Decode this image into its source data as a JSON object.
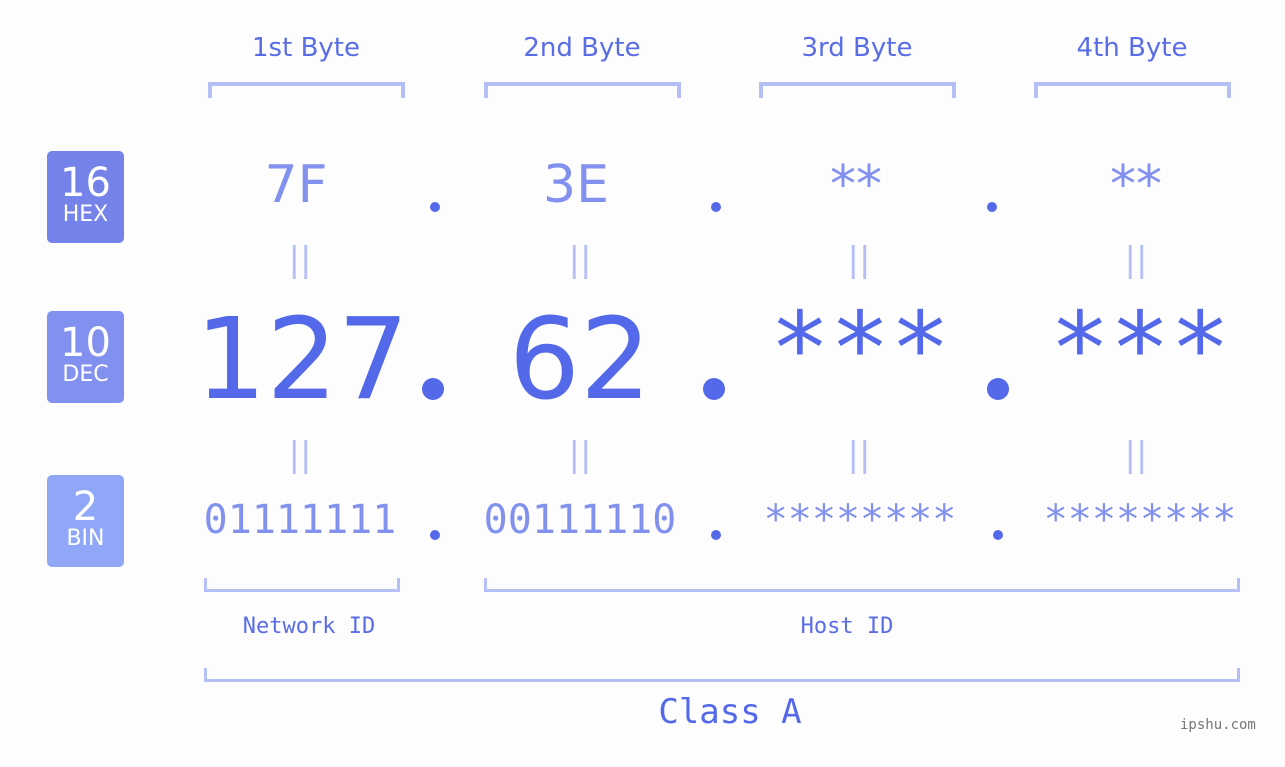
{
  "badges": [
    {
      "num": "16",
      "label": "HEX",
      "color": "#7482ea"
    },
    {
      "num": "10",
      "label": "DEC",
      "color": "#8291f0"
    },
    {
      "num": "2",
      "label": "BIN",
      "color": "#90a7f8"
    }
  ],
  "bytes": [
    {
      "header": "1st Byte",
      "hex": "7F",
      "dec": "127",
      "bin": "01111111"
    },
    {
      "header": "2nd Byte",
      "hex": "3E",
      "dec": "62",
      "bin": "00111110"
    },
    {
      "header": "3rd Byte",
      "hex": "**",
      "dec": "***",
      "bin": "********"
    },
    {
      "header": "4th Byte",
      "hex": "**",
      "dec": "***",
      "bin": "********"
    }
  ],
  "equals_glyph": "||",
  "network_label": "Network ID",
  "host_label": "Host ID",
  "class_label": "Class A",
  "watermark": "ipshu.com",
  "colors": {
    "primary": "#5469ea",
    "light": "#8391ee",
    "bracket": "#b4bff5"
  }
}
